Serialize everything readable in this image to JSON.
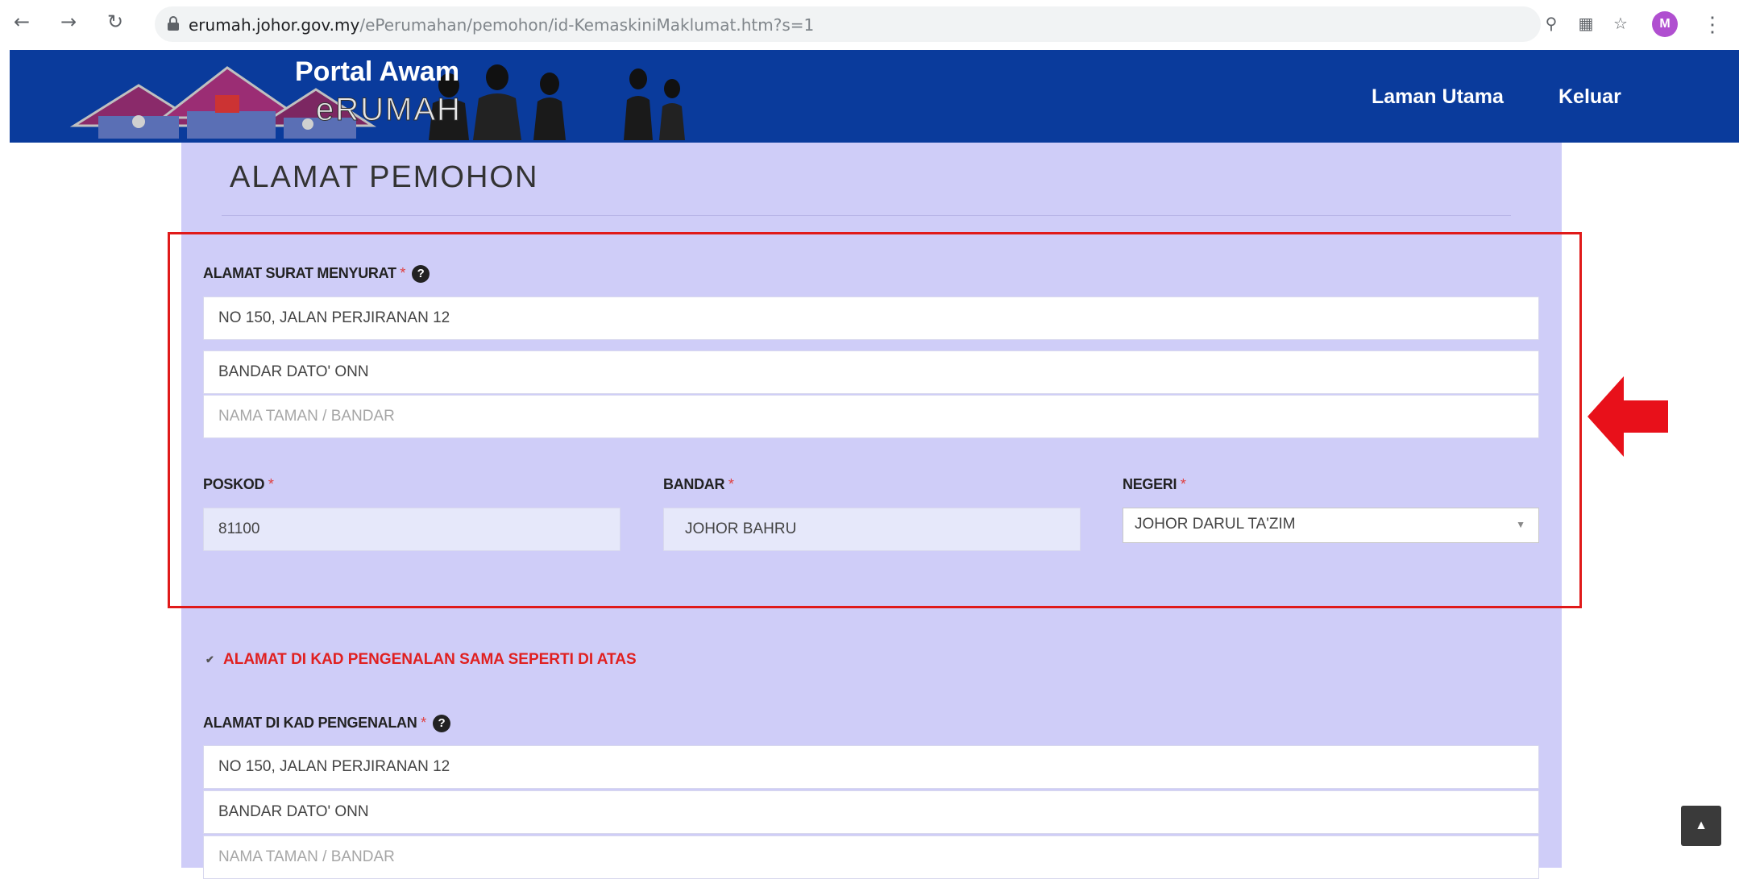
{
  "browser": {
    "url_host": "erumah.johor.gov.my",
    "url_path": "/ePerumahan/pemohon/id-KemaskiniMaklumat.htm?s=1",
    "avatar_letter": "M"
  },
  "header": {
    "brand_title": "Portal Awam",
    "brand_sub": "eRUMAH",
    "links": [
      "Laman Utama",
      "Keluar"
    ],
    "bg_color": "#0a3b9c"
  },
  "page": {
    "title": "ALAMAT PEMOHON",
    "panel_color": "#cfcdf8"
  },
  "mailing_address": {
    "label": "ALAMAT SURAT MENYURAT",
    "required_mark": "*",
    "line1": "NO 150, JALAN PERJIRANAN 12",
    "line2": "BANDAR DATO' ONN",
    "line3_placeholder": "NAMA TAMAN / BANDAR"
  },
  "location": {
    "postcode_label": "POSKOD",
    "postcode_value": "81100",
    "city_label": "BANDAR",
    "city_value": "JOHOR BAHRU",
    "state_label": "NEGERI",
    "state_value": "JOHOR DARUL TA'ZIM",
    "required_mark": "*"
  },
  "same_address_checkbox": {
    "label": "ALAMAT DI KAD PENGENALAN SAMA SEPERTI DI ATAS",
    "checked": true
  },
  "ic_address": {
    "label": "ALAMAT DI KAD PENGENALAN",
    "required_mark": "*",
    "line1": "NO 150, JALAN PERJIRANAN 12",
    "line2": "BANDAR DATO' ONN",
    "line3_placeholder": "NAMA TAMAN / BANDAR"
  },
  "annotation_color": "#e01a1a"
}
